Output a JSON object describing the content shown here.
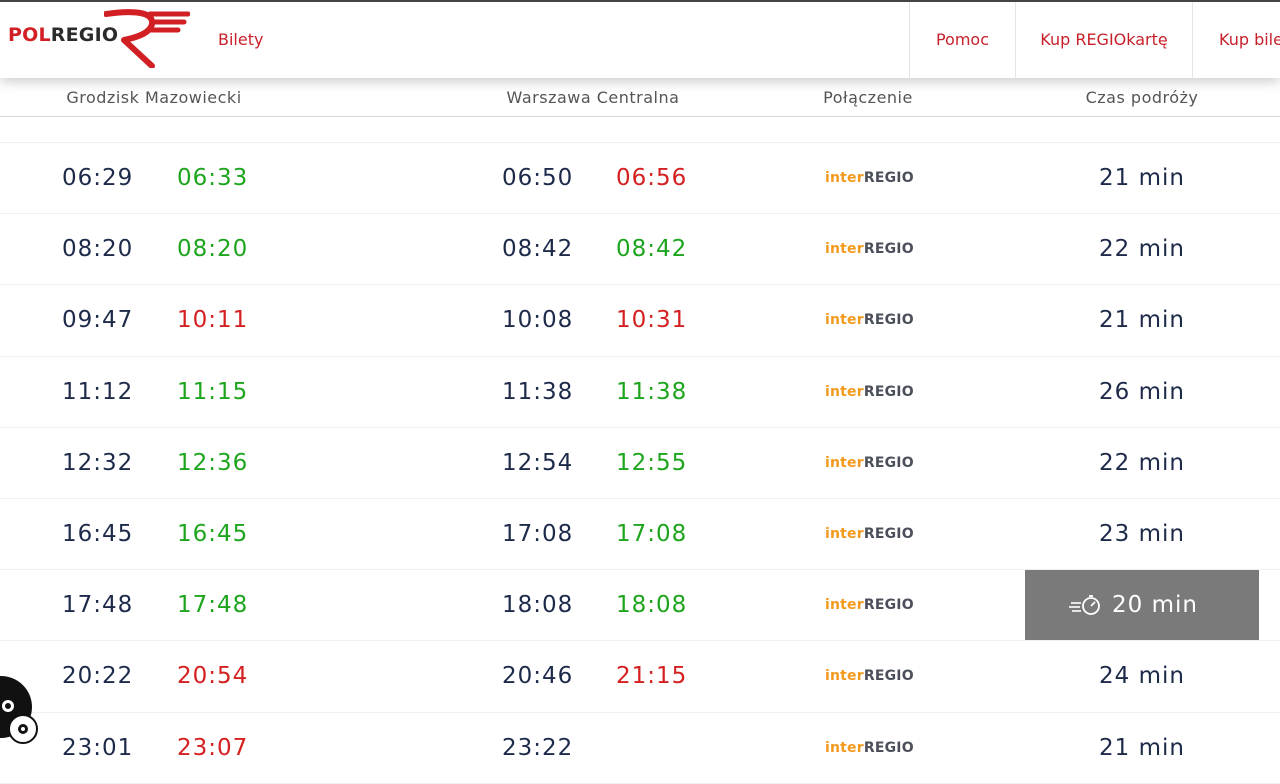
{
  "header": {
    "logo": {
      "pol": "POL",
      "regio": "REGIO"
    },
    "nav_left": "Bilety",
    "nav_right": [
      "Pomoc",
      "Kup REGIOkartę",
      "Kup bile"
    ]
  },
  "columns": {
    "from": "Grodzisk Mazowiecki",
    "to": "Warszawa Centralna",
    "connection": "Połączenie",
    "duration": "Czas podróży"
  },
  "carrier": {
    "inter": "inter",
    "regio": "REGIO"
  },
  "colors": {
    "green": "#1ea51e",
    "red": "#d42020",
    "brand_red": "#c8202a",
    "highlight": "#7a7a7a"
  },
  "rows": [
    {
      "dep": "06:29",
      "dep_real": "06:33",
      "dep_status": "green",
      "arr": "06:50",
      "arr_real": "06:56",
      "arr_status": "red",
      "duration": "21 min"
    },
    {
      "dep": "08:20",
      "dep_real": "08:20",
      "dep_status": "green",
      "arr": "08:42",
      "arr_real": "08:42",
      "arr_status": "green",
      "duration": "22 min"
    },
    {
      "dep": "09:47",
      "dep_real": "10:11",
      "dep_status": "red",
      "arr": "10:08",
      "arr_real": "10:31",
      "arr_status": "red",
      "duration": "21 min"
    },
    {
      "dep": "11:12",
      "dep_real": "11:15",
      "dep_status": "green",
      "arr": "11:38",
      "arr_real": "11:38",
      "arr_status": "green",
      "duration": "26 min"
    },
    {
      "dep": "12:32",
      "dep_real": "12:36",
      "dep_status": "green",
      "arr": "12:54",
      "arr_real": "12:55",
      "arr_status": "green",
      "duration": "22 min"
    },
    {
      "dep": "16:45",
      "dep_real": "16:45",
      "dep_status": "green",
      "arr": "17:08",
      "arr_real": "17:08",
      "arr_status": "green",
      "duration": "23 min"
    },
    {
      "dep": "17:48",
      "dep_real": "17:48",
      "dep_status": "green",
      "arr": "18:08",
      "arr_real": "18:08",
      "arr_status": "green",
      "duration": "20 min",
      "fastest": true,
      "icon": "fast-stopwatch-icon"
    },
    {
      "dep": "20:22",
      "dep_real": "20:54",
      "dep_status": "red",
      "arr": "20:46",
      "arr_real": "21:15",
      "arr_status": "red",
      "duration": "24 min"
    },
    {
      "dep": "23:01",
      "dep_real": "23:07",
      "dep_status": "red",
      "arr": "23:22",
      "arr_real": "",
      "arr_status": "red",
      "duration": "21 min"
    }
  ]
}
